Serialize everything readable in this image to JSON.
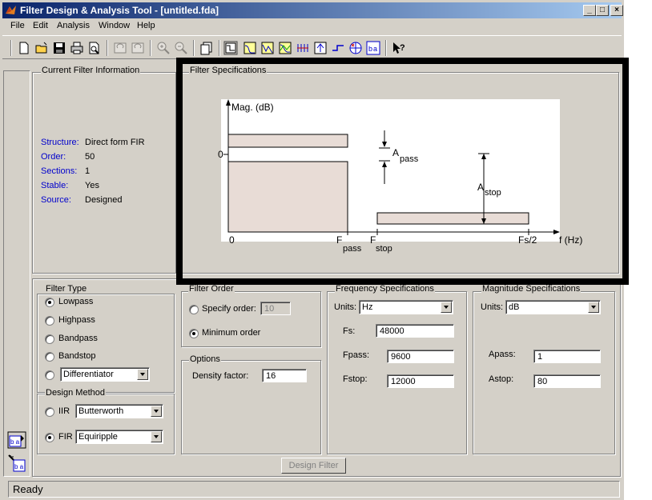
{
  "window": {
    "title": "Filter Design & Analysis Tool - [untitled.fda]",
    "controls": [
      "_",
      "□",
      "×"
    ]
  },
  "menu": [
    "File",
    "Edit",
    "Analysis",
    "Window",
    "Help"
  ],
  "toolbar": {
    "icons": [
      "new-icon",
      "open-icon",
      "save-icon",
      "print-icon",
      "print-preview-icon",
      "undo-icon",
      "redo-icon",
      "zoom-in-icon",
      "zoom-out-icon",
      "new-figure-icon",
      "filter-specs-icon",
      "magnitude-icon",
      "phase-icon",
      "mag-phase-icon",
      "group-delay-icon",
      "impulse-icon",
      "step-icon",
      "pole-zero-icon",
      "coefficients-icon",
      "whats-this-icon"
    ]
  },
  "current_filter": {
    "title": "Current Filter Information",
    "rows": [
      {
        "label": "Structure:",
        "value": "Direct form FIR"
      },
      {
        "label": "Order:",
        "value": "50"
      },
      {
        "label": "Sections:",
        "value": "1"
      },
      {
        "label": "Stable:",
        "value": "Yes"
      },
      {
        "label": "Source:",
        "value": "Designed"
      }
    ]
  },
  "filter_specs": {
    "title": "Filter Specifications",
    "ylabel": "Mag. (dB)",
    "zero_y": "0",
    "zero_x": "0",
    "fpass_main": "F",
    "fpass_sub": "pass",
    "fstop_main": "F",
    "fstop_sub": "stop",
    "fs2": "Fs/2",
    "xlabel": "f (Hz)",
    "apass_main": "A",
    "apass_sub": "pass",
    "astop_main": "A",
    "astop_sub": "stop"
  },
  "filter_type": {
    "title": "Filter Type",
    "options": [
      "Lowpass",
      "Highpass",
      "Bandpass",
      "Bandstop"
    ],
    "selected": "Lowpass",
    "differentiator": "Differentiator"
  },
  "design_method": {
    "title": "Design Method",
    "iir_label": "IIR",
    "iir_value": "Butterworth",
    "fir_label": "FIR",
    "fir_value": "Equiripple",
    "selected": "FIR"
  },
  "filter_order": {
    "title": "Filter Order",
    "specify_label": "Specify order:",
    "specify_value": "10",
    "minimum_label": "Minimum order",
    "selected": "Minimum order"
  },
  "options": {
    "title": "Options",
    "density_label": "Density factor:",
    "density_value": "16"
  },
  "freq_specs": {
    "title": "Frequency Specifications",
    "units_label": "Units:",
    "units_value": "Hz",
    "fs_label": "Fs:",
    "fs_value": "48000",
    "fpass_label": "Fpass:",
    "fpass_value": "9600",
    "fstop_label": "Fstop:",
    "fstop_value": "12000"
  },
  "mag_specs": {
    "title": "Magnitude Specifications",
    "units_label": "Units:",
    "units_value": "dB",
    "apass_label": "Apass:",
    "apass_value": "1",
    "astop_label": "Astop:",
    "astop_value": "80"
  },
  "design_button": "Design Filter",
  "status": "Ready"
}
